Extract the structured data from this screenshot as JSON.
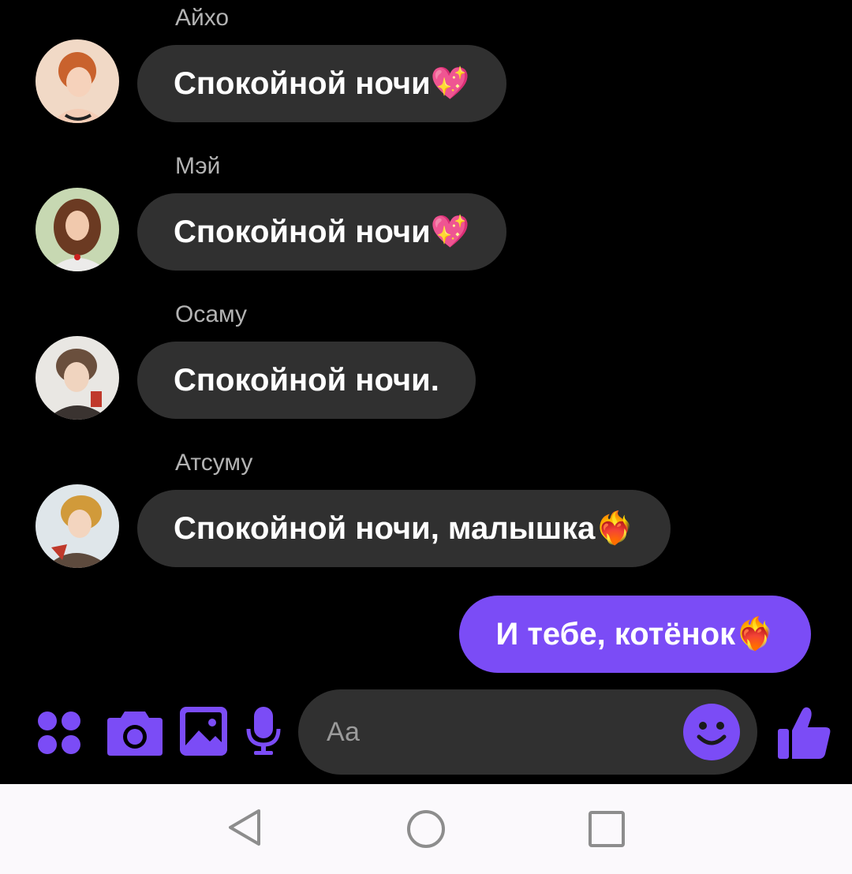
{
  "messages": [
    {
      "sender": "Айхо",
      "text": "Спокойной ночи💖",
      "avatar": "avatar-aiho"
    },
    {
      "sender": "Мэй",
      "text": "Спокойной ночи💖",
      "avatar": "avatar-mei"
    },
    {
      "sender": "Осаму",
      "text": "Спокойной ночи.",
      "avatar": "avatar-osamu"
    },
    {
      "sender": "Атсуму",
      "text": "Спокойной ночи, малышка❤️‍🔥",
      "avatar": "avatar-atsumu"
    }
  ],
  "outgoing": {
    "text": "И тебе, котёнок❤️‍🔥"
  },
  "composer": {
    "placeholder": "Аа",
    "icons": [
      "apps-icon",
      "camera-icon",
      "gallery-icon",
      "microphone-icon",
      "emoji-icon",
      "thumbs-up-icon"
    ],
    "accent": "#7b4cf6"
  },
  "navbar": {
    "icons": [
      "back-icon",
      "home-icon",
      "recents-icon"
    ]
  }
}
